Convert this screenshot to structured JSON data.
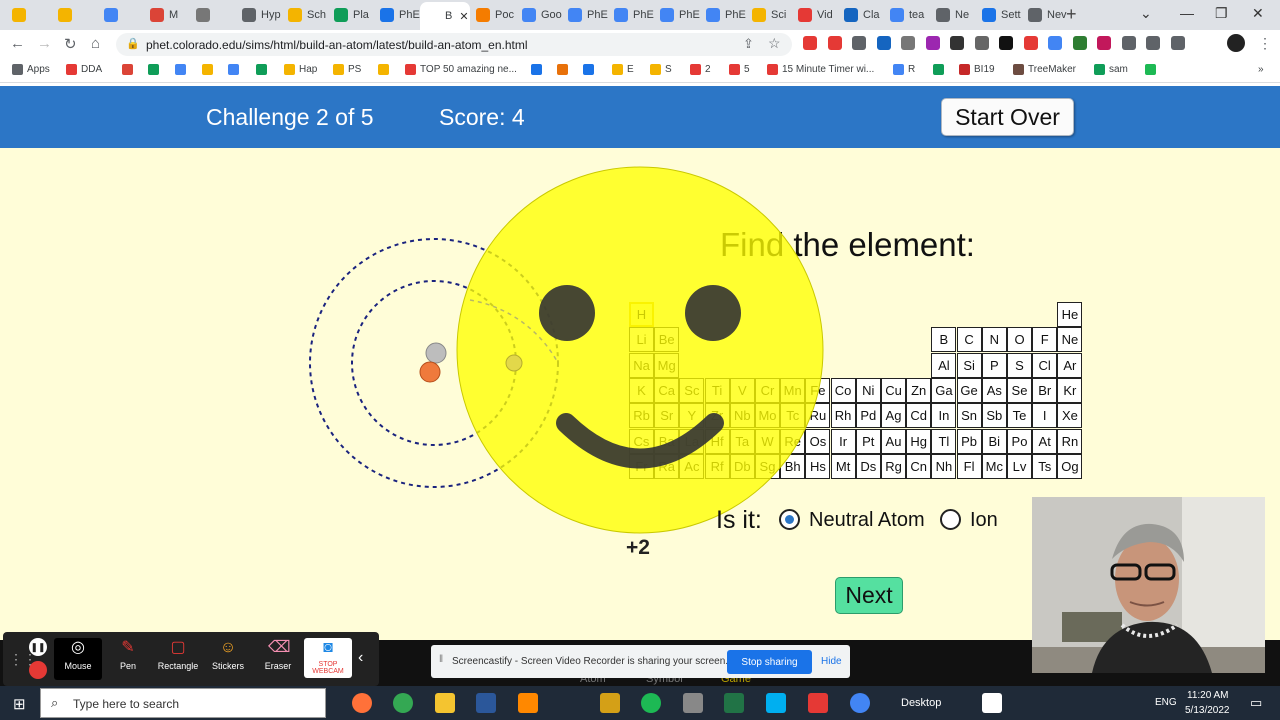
{
  "browser": {
    "tabs": [
      {
        "label": "",
        "color": "#f4b400"
      },
      {
        "label": "",
        "color": "#f4b400"
      },
      {
        "label": "",
        "color": "#4285f4"
      },
      {
        "label": "M",
        "color": "#db4437"
      },
      {
        "label": "",
        "color": "#777777"
      },
      {
        "label": "Hyp",
        "color": "#5f6368"
      },
      {
        "label": "Sch",
        "color": "#f4b400"
      },
      {
        "label": "Pla",
        "color": "#0f9d58"
      },
      {
        "label": "PhE",
        "color": "#1a73e8"
      },
      {
        "label": "B",
        "color": "#ffffff",
        "active": true
      },
      {
        "label": "Poc",
        "color": "#f57c00"
      },
      {
        "label": "Goo",
        "color": "#4285f4"
      },
      {
        "label": "PhE",
        "color": "#4285f4"
      },
      {
        "label": "PhE",
        "color": "#4285f4"
      },
      {
        "label": "PhE",
        "color": "#4285f4"
      },
      {
        "label": "PhE",
        "color": "#4285f4"
      },
      {
        "label": "Sci",
        "color": "#f4b400"
      },
      {
        "label": "Vid",
        "color": "#e53935"
      },
      {
        "label": "Cla",
        "color": "#1565c0"
      },
      {
        "label": "tea",
        "color": "#4285f4"
      },
      {
        "label": "Ne",
        "color": "#5f6368"
      },
      {
        "label": "Sett",
        "color": "#1a73e8"
      },
      {
        "label": "Nev",
        "color": "#5f6368"
      }
    ],
    "url": "phet.colorado.edu/sims/html/build-an-atom/latest/build-an-atom_en.html",
    "bookmarks": [
      {
        "label": "Apps",
        "color": "#5f6368"
      },
      {
        "label": "DDA",
        "color": "#e53935"
      },
      {
        "label": "",
        "color": "#db4437"
      },
      {
        "label": "",
        "color": "#0f9d58"
      },
      {
        "label": "",
        "color": "#4285f4"
      },
      {
        "label": "",
        "color": "#f4b400"
      },
      {
        "label": "",
        "color": "#4285f4"
      },
      {
        "label": "",
        "color": "#0f9d58"
      },
      {
        "label": "Hap",
        "color": "#f4b400"
      },
      {
        "label": "PS",
        "color": "#f4b400"
      },
      {
        "label": "",
        "color": "#f4b400"
      },
      {
        "label": "TOP 50 amazing ne...",
        "color": "#e53935"
      },
      {
        "label": "",
        "color": "#1a73e8"
      },
      {
        "label": "",
        "color": "#e8710a"
      },
      {
        "label": "",
        "color": "#1a73e8"
      },
      {
        "label": "E",
        "color": "#f4b400"
      },
      {
        "label": "S",
        "color": "#f4b400"
      },
      {
        "label": "2",
        "color": "#e53935"
      },
      {
        "label": "5",
        "color": "#e53935"
      },
      {
        "label": "15 Minute Timer wi...",
        "color": "#e53935"
      },
      {
        "label": "R",
        "color": "#4285f4"
      },
      {
        "label": "",
        "color": "#0f9d58"
      },
      {
        "label": "BI19",
        "color": "#c62828"
      },
      {
        "label": "TreeMaker",
        "color": "#6d4c41"
      },
      {
        "label": "sam",
        "color": "#0f9d58"
      },
      {
        "label": "",
        "color": "#1db954"
      }
    ]
  },
  "sim": {
    "challenge": "Challenge 2 of 5",
    "score": "Score: 4",
    "start_over": "Start Over",
    "prompt": "Find the element:",
    "is_it": "Is it:",
    "neutral": "Neutral Atom",
    "ion": "Ion",
    "selected": "neutral",
    "charge": "+2",
    "next": "Next",
    "highlight": "H",
    "elements": [
      [
        "H",
        "",
        "",
        "",
        "",
        "",
        "",
        "",
        "",
        "",
        "",
        "",
        "",
        "",
        "",
        "",
        "",
        "He"
      ],
      [
        "Li",
        "Be",
        "",
        "",
        "",
        "",
        "",
        "",
        "",
        "",
        "",
        "",
        "B",
        "C",
        "N",
        "O",
        "F",
        "Ne"
      ],
      [
        "Na",
        "Mg",
        "",
        "",
        "",
        "",
        "",
        "",
        "",
        "",
        "",
        "",
        "Al",
        "Si",
        "P",
        "S",
        "Cl",
        "Ar"
      ],
      [
        "K",
        "Ca",
        "Sc",
        "Ti",
        "V",
        "Cr",
        "Mn",
        "Fe",
        "Co",
        "Ni",
        "Cu",
        "Zn",
        "Ga",
        "Ge",
        "As",
        "Se",
        "Br",
        "Kr"
      ],
      [
        "Rb",
        "Sr",
        "Y",
        "Zr",
        "Nb",
        "Mo",
        "Tc",
        "Ru",
        "Rh",
        "Pd",
        "Ag",
        "Cd",
        "In",
        "Sn",
        "Sb",
        "Te",
        "I",
        "Xe"
      ],
      [
        "Cs",
        "Ba",
        "La",
        "Hf",
        "Ta",
        "W",
        "Re",
        "Os",
        "Ir",
        "Pt",
        "Au",
        "Hg",
        "Tl",
        "Pb",
        "Bi",
        "Po",
        "At",
        "Rn"
      ],
      [
        "Fr",
        "Ra",
        "Ac",
        "Rf",
        "Db",
        "Sg",
        "Bh",
        "Hs",
        "Mt",
        "Ds",
        "Rg",
        "Cn",
        "Nh",
        "Fl",
        "Mc",
        "Lv",
        "Ts",
        "Og"
      ]
    ],
    "tabs": [
      "Atom",
      "Symbol",
      "Game"
    ]
  },
  "screencastify": {
    "tools": [
      "Mouse",
      "Pen",
      "Rectangle",
      "Stickers",
      "Eraser",
      "STOP WEBCAM"
    ],
    "share_text": "Screencastify - Screen Video Recorder is sharing your screen.",
    "stop_sharing": "Stop sharing",
    "hide": "Hide"
  },
  "taskbar": {
    "search_placeholder": "Type here to search",
    "desktop": "Desktop",
    "lang": "ENG",
    "time": "11:20 AM",
    "date": "5/13/2022"
  }
}
